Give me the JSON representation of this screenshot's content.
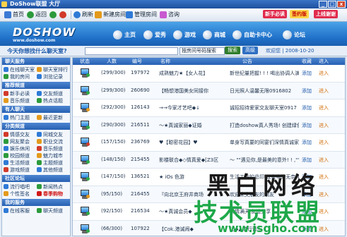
{
  "window": {
    "title": "DoShow联盟 大厅"
  },
  "toolbar": {
    "items": [
      "首页",
      "返回",
      "前进",
      "刷新",
      "刷新",
      "新建房间",
      "管理房间",
      "咨询"
    ],
    "promo1": "新手必读",
    "promo2": "签约版",
    "promo3": "上线谢谢"
  },
  "banner": {
    "logo": "DOSHOW",
    "logo_sub": "www.doshow.com",
    "nav": [
      "主页",
      "爱秀",
      "游戏",
      "商城",
      "自助卡中心",
      "论坛"
    ]
  },
  "search": {
    "label": "今天你想找什么聊天室?",
    "select_value": "按房间号码搜索",
    "button": "搜索",
    "button2": "高级",
    "user_info": "欢迎您 | 2008-10-20"
  },
  "sidebar": {
    "sections": [
      {
        "title": "聊天服务",
        "items": [
          {
            "label": "在线聊天室",
            "color": "#2f7ad6",
            "hot": false
          },
          {
            "label": "聊天室排行",
            "color": "#e39a1c",
            "hot": false
          },
          {
            "label": "我的房间",
            "color": "#2c9a3c",
            "hot": false
          },
          {
            "label": "浏览记录",
            "color": "#2f7ad6",
            "hot": false
          }
        ]
      },
      {
        "title": "推荐频道",
        "items": [
          {
            "label": "新手必读",
            "color": "#d23a2a",
            "hot": false
          },
          {
            "label": "交友频道",
            "color": "#2f7ad6",
            "hot": false
          },
          {
            "label": "音乐频道",
            "color": "#e39a1c",
            "hot": false
          },
          {
            "label": "热点话题",
            "color": "#2c9a3c",
            "hot": false
          }
        ]
      },
      {
        "title": "有人聊天",
        "items": [
          {
            "label": "热门主题",
            "color": "#2f7ad6",
            "hot": false
          },
          {
            "label": "最近更新",
            "color": "#e39a1c",
            "hot": false
          }
        ]
      },
      {
        "title": "分类频道",
        "items": [
          {
            "label": "情感交友",
            "color": "#d23a2a",
            "hot": false
          },
          {
            "label": "同城交友",
            "color": "#2f7ad6",
            "hot": false
          },
          {
            "label": "网友聚会",
            "color": "#2c9a3c",
            "hot": false
          },
          {
            "label": "职业交流",
            "color": "#e39a1c",
            "hot": false
          },
          {
            "label": "娱乐休闲",
            "color": "#2f7ad6",
            "hot": false
          },
          {
            "label": "音乐频道",
            "color": "#d23a2a",
            "hot": false
          },
          {
            "label": "校园频道",
            "color": "#2c9a3c",
            "hot": false
          },
          {
            "label": "魅力城市",
            "color": "#e39a1c",
            "hot": false
          },
          {
            "label": "生活频道",
            "color": "#2f7ad6",
            "hot": false
          },
          {
            "label": "主题频道",
            "color": "#2c9a3c",
            "hot": false
          },
          {
            "label": "游戏频道",
            "color": "#d23a2a",
            "hot": false
          },
          {
            "label": "其他频道",
            "color": "#2f7ad6",
            "hot": false
          }
        ]
      },
      {
        "title": "社区论坛",
        "items": [
          {
            "label": "流行唱吧",
            "color": "#2f7ad6",
            "hot": false
          },
          {
            "label": "新闻热点",
            "color": "#2c9a3c",
            "hot": false
          },
          {
            "label": "个性签名",
            "color": "#e39a1c",
            "hot": false
          },
          {
            "label": "春季购物",
            "color": "#d21818",
            "hot": true
          }
        ]
      },
      {
        "title": "我的服务",
        "items": [
          {
            "label": "在线客服",
            "color": "#2f7ad6",
            "hot": false
          },
          {
            "label": "聊天频道",
            "color": "#2c9a3c",
            "hot": false
          }
        ]
      }
    ]
  },
  "table": {
    "headers": [
      "状态",
      "人数",
      "编号",
      "名称",
      "公告",
      "收藏",
      "进入"
    ],
    "rows": [
      {
        "count": "(299/300)",
        "id": "197972",
        "name": "成熟魅力★【女人花】",
        "notice": "新世纪量把握! ! ! 喝出协调人演唱! ! ! 秀出女人对爱和热 ! ! !",
        "add": "添加",
        "enter": "进入",
        "dot": "#2ca845"
      },
      {
        "count": "(299/300)",
        "id": "260690",
        "name": "【畅想港国美女同接你",
        "notice": "日光照人温馨无限0916802",
        "add": "添加",
        "enter": "进入",
        "dot": "#2ca845"
      },
      {
        "count": "(292/300)",
        "id": "126143",
        "name": "→→今家才艺吧◆↓",
        "notice": "诚招招待爱家交友聊天室0917",
        "add": "添加",
        "enter": "进入",
        "dot": "#e39a1c"
      },
      {
        "count": "(290/300)",
        "id": "216511",
        "name": "〜★真诚家丽◆证婚",
        "notice": "打造doshow真人秀场! 创建绿色文明频道/普通室有聊天环境",
        "add": "添加",
        "enter": "进入",
        "dot": "#2ca845"
      },
      {
        "count": "(157/150)",
        "id": "236769",
        "name": "♥【聪密花园】♥",
        "notice": "单身写真要的同宴们深情真诚家聚证婚频道",
        "add": "添加",
        "enter": "进入",
        "dot": "#d23a2a"
      },
      {
        "count": "(148/150)",
        "id": "215455",
        "name": "影楼联合◆◇情真爱◆[Z3区",
        "notice": "〜 \"\"遇见你,是最美的意外! ! ,\"\"",
        "add": "添加",
        "enter": "进入",
        "dot": "#2ca845"
      },
      {
        "count": "(147/150)",
        "id": "136521",
        "name": "★ iOs 色游",
        "notice": "生活工作的总印,既实中的无奈;我的生活在这里",
        "add": "添加",
        "enter": "进入",
        "dot": "#2ca845"
      },
      {
        "count": "(95/150)",
        "id": "216455",
        "name": "『向北京王府井商场",
        "notice": "欢迎来交朋友的朋友",
        "add": "添加",
        "enter": "进入",
        "dot": "#e39a1c"
      },
      {
        "count": "(92/150)",
        "id": "216534",
        "name": "〜★真诚会员◆",
        "notice": "真情满天,友谊分享",
        "add": "添加",
        "enter": "进入",
        "dot": "#2ca845"
      },
      {
        "count": "(66/300)",
        "id": "107922",
        "name": "【Cok.港诚闹◆",
        "notice": "让◆▲流行音乐",
        "add": "添加",
        "enter": "进入",
        "dot": "#2ca845"
      }
    ]
  },
  "watermark": {
    "line1": "黑白网络",
    "line2": "技术员联盟",
    "line3": "www.jsgho.com"
  },
  "colors": {
    "accent": "#2660b2",
    "banner": "#1f6fc8",
    "watermark_green": "#1ea84a"
  }
}
